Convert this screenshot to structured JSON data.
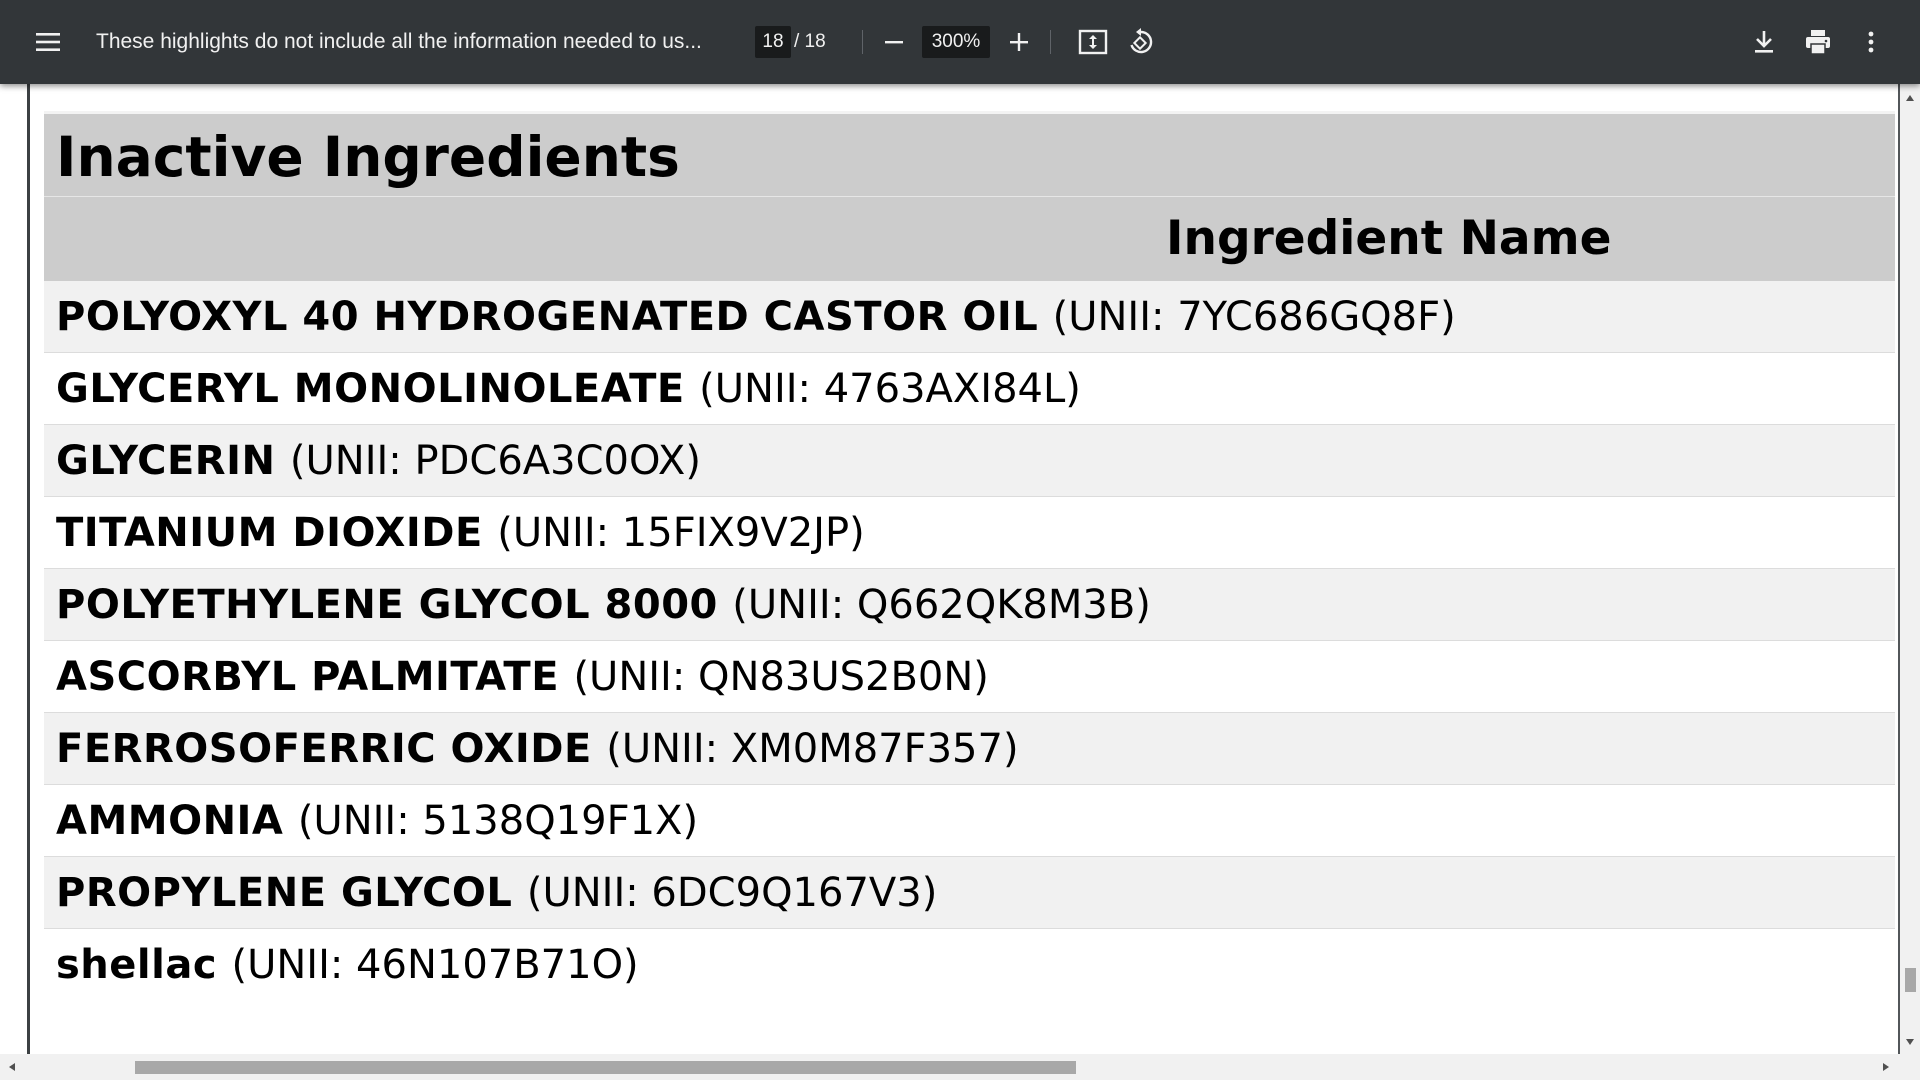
{
  "toolbar": {
    "title": "These highlights do not include all the information needed to us...",
    "current_page": "18",
    "page_separator": "/ 18",
    "zoom": "300%",
    "icons": {
      "menu": "hamburger-menu-icon",
      "zoom_out": "minus-icon",
      "zoom_in": "plus-icon",
      "fit": "fit-to-page-icon",
      "rotate": "rotate-icon",
      "download": "download-icon",
      "print": "print-icon",
      "more": "more-vertical-icon"
    }
  },
  "document": {
    "table_caption": "Inactive Ingredients",
    "column_header": "Ingredient Name",
    "rows": [
      {
        "name": "POLYOXYL 40 HYDROGENATED CASTOR OIL",
        "unii": "(UNII: 7YC686GQ8F)"
      },
      {
        "name": "GLYCERYL MONOLINOLEATE",
        "unii": "(UNII: 4763AXI84L)"
      },
      {
        "name": "GLYCERIN",
        "unii": "(UNII: PDC6A3C0OX)"
      },
      {
        "name": "TITANIUM DIOXIDE",
        "unii": "(UNII: 15FIX9V2JP)"
      },
      {
        "name": "POLYETHYLENE GLYCOL 8000",
        "unii": "(UNII: Q662QK8M3B)"
      },
      {
        "name": "ASCORBYL PALMITATE",
        "unii": "(UNII: QN83US2B0N)"
      },
      {
        "name": "FERROSOFERRIC OXIDE",
        "unii": "(UNII: XM0M87F357)"
      },
      {
        "name": "AMMONIA",
        "unii": "(UNII: 5138Q19F1X)"
      },
      {
        "name": "PROPYLENE GLYCOL",
        "unii": "(UNII: 6DC9Q167V3)"
      },
      {
        "name": "shellac",
        "unii": "(UNII: 46N107B71O)"
      }
    ]
  },
  "colors": {
    "toolbar_bg": "#323639",
    "viewer_bg": "#525659",
    "header_bg": "#cccccc",
    "row_alt_bg": "#f1f1f1"
  }
}
